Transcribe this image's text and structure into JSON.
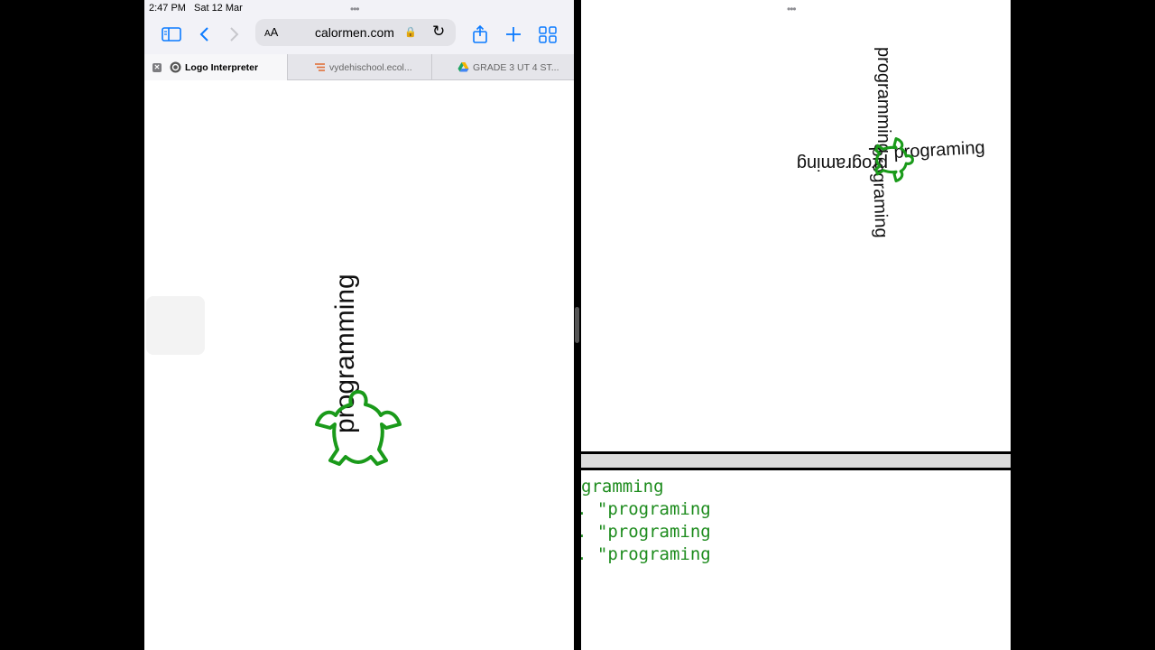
{
  "status": {
    "time": "2:47 PM",
    "date": "Sat 12 Mar",
    "dots": "•••"
  },
  "toolbar": {
    "aa_small": "A",
    "aa_large": "A",
    "url": "calormen.com",
    "lock": "🔒",
    "reload": "↻"
  },
  "tabs": [
    {
      "label": "Logo Interpreter",
      "active": true,
      "close": "✕"
    },
    {
      "label": "vydehischool.ecol...",
      "active": false
    },
    {
      "label": "GRADE 3 UT 4 ST...",
      "active": false
    }
  ],
  "left_canvas": {
    "turtle_text": "programming",
    "turtle_color": "#1a9a1a"
  },
  "right_canvas": {
    "dots": "•••",
    "text_up": "programming",
    "text_right": "programing",
    "text_down": "programing",
    "text_left": "programing",
    "turtle_color": "#1a9a1a"
  },
  "code": {
    "lines": [
      "gramming",
      ". \"programing",
      ". \"programing",
      ". \"programing"
    ],
    "color": "#1e8c1e"
  }
}
